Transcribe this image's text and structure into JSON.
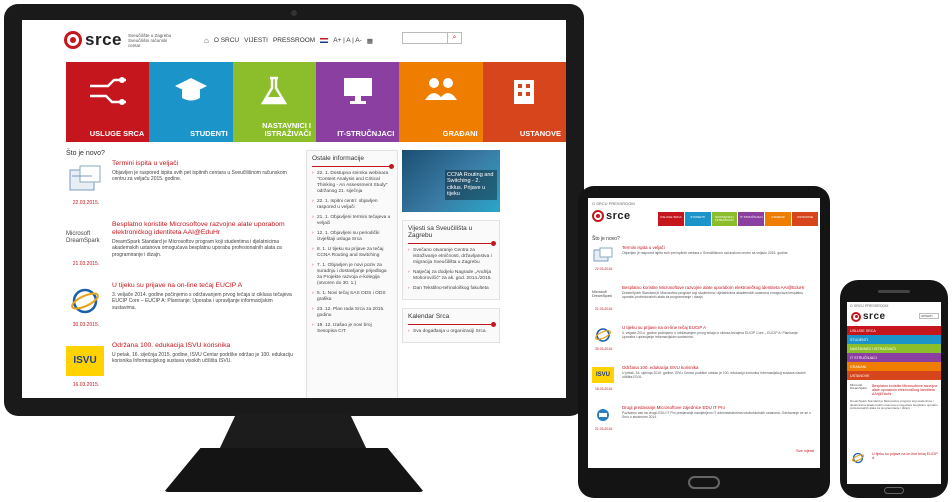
{
  "colors": {
    "brand_red": "#c4161c",
    "tile_colors": [
      "#c4161c",
      "#1a94c9",
      "#8cbe2b",
      "#8b3fa0",
      "#ef7d00",
      "#d6451b"
    ]
  },
  "desktop": {
    "logo": {
      "word": "srce",
      "tagline": "Sveučilište u Zagrebu Sveučilišni računski centar"
    },
    "nav": {
      "home_icon": "home-icon",
      "items": [
        "O SRCU",
        "VIJESTI",
        "PRESSROOM"
      ],
      "font_size": "A+ | A | A-"
    },
    "search": {
      "placeholder": "",
      "icon": "search-icon"
    },
    "tiles": [
      {
        "label": "USLUGE SRCA",
        "icon": "circuit-icon"
      },
      {
        "label": "STUDENTI",
        "icon": "graduation-cap-icon"
      },
      {
        "label": "NASTAVNICI I ISTRAŽIVAČI",
        "icon": "flask-icon"
      },
      {
        "label": "IT-STRUČNJACI",
        "icon": "monitor-icon"
      },
      {
        "label": "GRAĐANI",
        "icon": "people-icon"
      },
      {
        "label": "USTANOVE",
        "icon": "building-icon"
      }
    ],
    "news_title": "Što je novo?",
    "news": [
      {
        "title": "Termini ispita u veljači",
        "body": "Objavljen je raspored ispita svih pet ispitnih centara u Sveučilišnom računskom centru za veljaču 2015. godine.",
        "date": "22.03.2015."
      },
      {
        "title": "Besplatno koristite Microsoftove razvojne alate uporabom elektroničkog identiteta AAI@EduHr",
        "body": "DreamSpark Standard je Microsoftov program koji studentima i djelatnicima akademskih ustanova omogućava besplatnu uporabu profesionalnih alata za programiranje i dizajn.",
        "date": "21.03.2015.",
        "brand": "Microsoft DreamSpark"
      },
      {
        "title": "U tijeku su prijave na on-line tečaj EUCIP A",
        "body": "3. veljače 2014. godine počinjemo s održavanjem prvog tečaja iz ciklusa tečajeva EUCIP Core – EUCIP A: Planiranje: Uporaba i upravljanje informacijskim sustavima.",
        "date": "30.03.2015."
      },
      {
        "title": "Održana 100. edukacija ISVU korisnika",
        "body": "U petak, 16. siječnja 2015. godine, ISVU Centar podrške održao je 100. edukaciju korisnika Informacijskog sustava visokih učilišta ISVU.",
        "date": "16.03.2015.",
        "brand": "ISVU"
      }
    ],
    "other_info": {
      "title": "Ostale informacije",
      "items": [
        "22. 1. Dostupna snimka webinara \"Content Analysis and Critical Thinking - An Assessment Study\" održanog 21. siječnja",
        "22. 1. Ispitni centri: objavljen raspored u veljači",
        "21. 1. Objavljeni termini tečajeva u veljači",
        "12. 1. Objavljeni su periodički izvještaji usluga Srca",
        "8. 1. U tijeku su prijave za tečaj CCNA Routing and Switching",
        "7. 1. Objavljen je novi poziv za suradnju i dostavljanje prijedloga za Projekte razvoja e-kolegija (otvoren do 30. 1.)",
        "5. 1. Novi tečaj SAS ODS i ODS grafika",
        "23. 12. Plan rada Srca za 2015. godinu",
        "19. 12. Izašao je novi broj Sesopisa CIT"
      ]
    },
    "promo": {
      "text": "CCNA Routing and Switching - 2. ciklus. Prijave u tijeku"
    },
    "university_news": {
      "title": "Vijesti sa Sveučilišta u Zagrebu",
      "items": [
        "Svečano otvaranje Centra za istraživanje etničnosti, državljanstva i migracija Sveučilišta u Zagrebu",
        "Natječaj za dodjelu Nagrade „Andrija Mohorovičić\" za ak. god. 2014./2015.",
        "Dan Tekstilno-tehnološkog fakulteta"
      ]
    },
    "calendar": {
      "title": "Kalendar Srca",
      "items": [
        "Sva događanja u organizaciji Srca"
      ]
    }
  },
  "tablet": {
    "topbar": "O SRCU  PRESSROOM",
    "tiles": [
      "USLUGE SRCA",
      "STUDENTI",
      "NASTAVNICI I ISTRAŽIVAČI",
      "IT STRUČNJACI",
      "GRAĐANI",
      "USTANOVE"
    ],
    "news_title": "Što je novo?",
    "news": [
      {
        "title": "Termini ispita u veljači",
        "body": "Objavljen je raspored ispita svih pet ispitnih centara u Sveučilišnom računskom centru za veljaču 2015. godine.",
        "date": "22.03.2015."
      },
      {
        "title": "Besplatno koristite Microsoftove razvojne alate uporabom elektroničkog identiteta AAI@EduHr",
        "body": "DreamSpark Standard je Microsoftov program koji studentima i djelatnicima akademskih ustanova omogućava besplatnu uporabu profesionalnih alata za programiranje i dizajn.",
        "date": "21.03.2015."
      },
      {
        "title": "U tijeku su prijave na on-line tečaj EUCIP A",
        "body": "3. veljače 2014. godine počinjemo s održavanjem prvog tečaja iz ciklusa tečajeva EUCIP Core – EUCIP A: Planiranje: Uporaba i upravljanje informacijskim sustavima.",
        "date": "30.03.2015."
      },
      {
        "title": "Održana 100. edukacija ISVU korisnika",
        "body": "U petak, 16. siječnja 2015. godine, ISVU Centar podrške održao je 100. edukaciju korisnika Informacijskog sustava visokih učilišta ISVU.",
        "date": "16.03.2015."
      },
      {
        "title": "Drugi predavanje Microsoftove zajednice EDU IT Pro",
        "body": "Pozivamo vas na drugo EDU IT Pro predavanje namijenjeno IT administratorima visokoškolskih ustanova. Održavanje će se u Srcu u studenom 2014.",
        "date": "21.03.2015."
      }
    ],
    "more": "Sve vijesti"
  },
  "phone": {
    "topbar": "O SRCU  PRESSROOM",
    "search_placeholder": "UPISATI",
    "menu": [
      "USLUGE SRCA",
      "STUDENTI",
      "NASTAVNICI I ISTRAŽIVAČI",
      "IT STRUČNJACI",
      "GRAĐANI",
      "USTANOVE"
    ],
    "news": [
      {
        "title": "Besplatno koristite Microsoftove razvojne alate uporabom elektroničkog identiteta AAI@EduHr",
        "body": "DreamSpark Standard je Microsoftov program koji studentima i djelatnicima akademskih ustanova omogućava besplatnu uporabu profesionalnih alata za programiranje i dizajn."
      },
      {
        "title": "U tijeku su prijave na on-line tečaj EUCIP A",
        "body": ""
      }
    ]
  }
}
